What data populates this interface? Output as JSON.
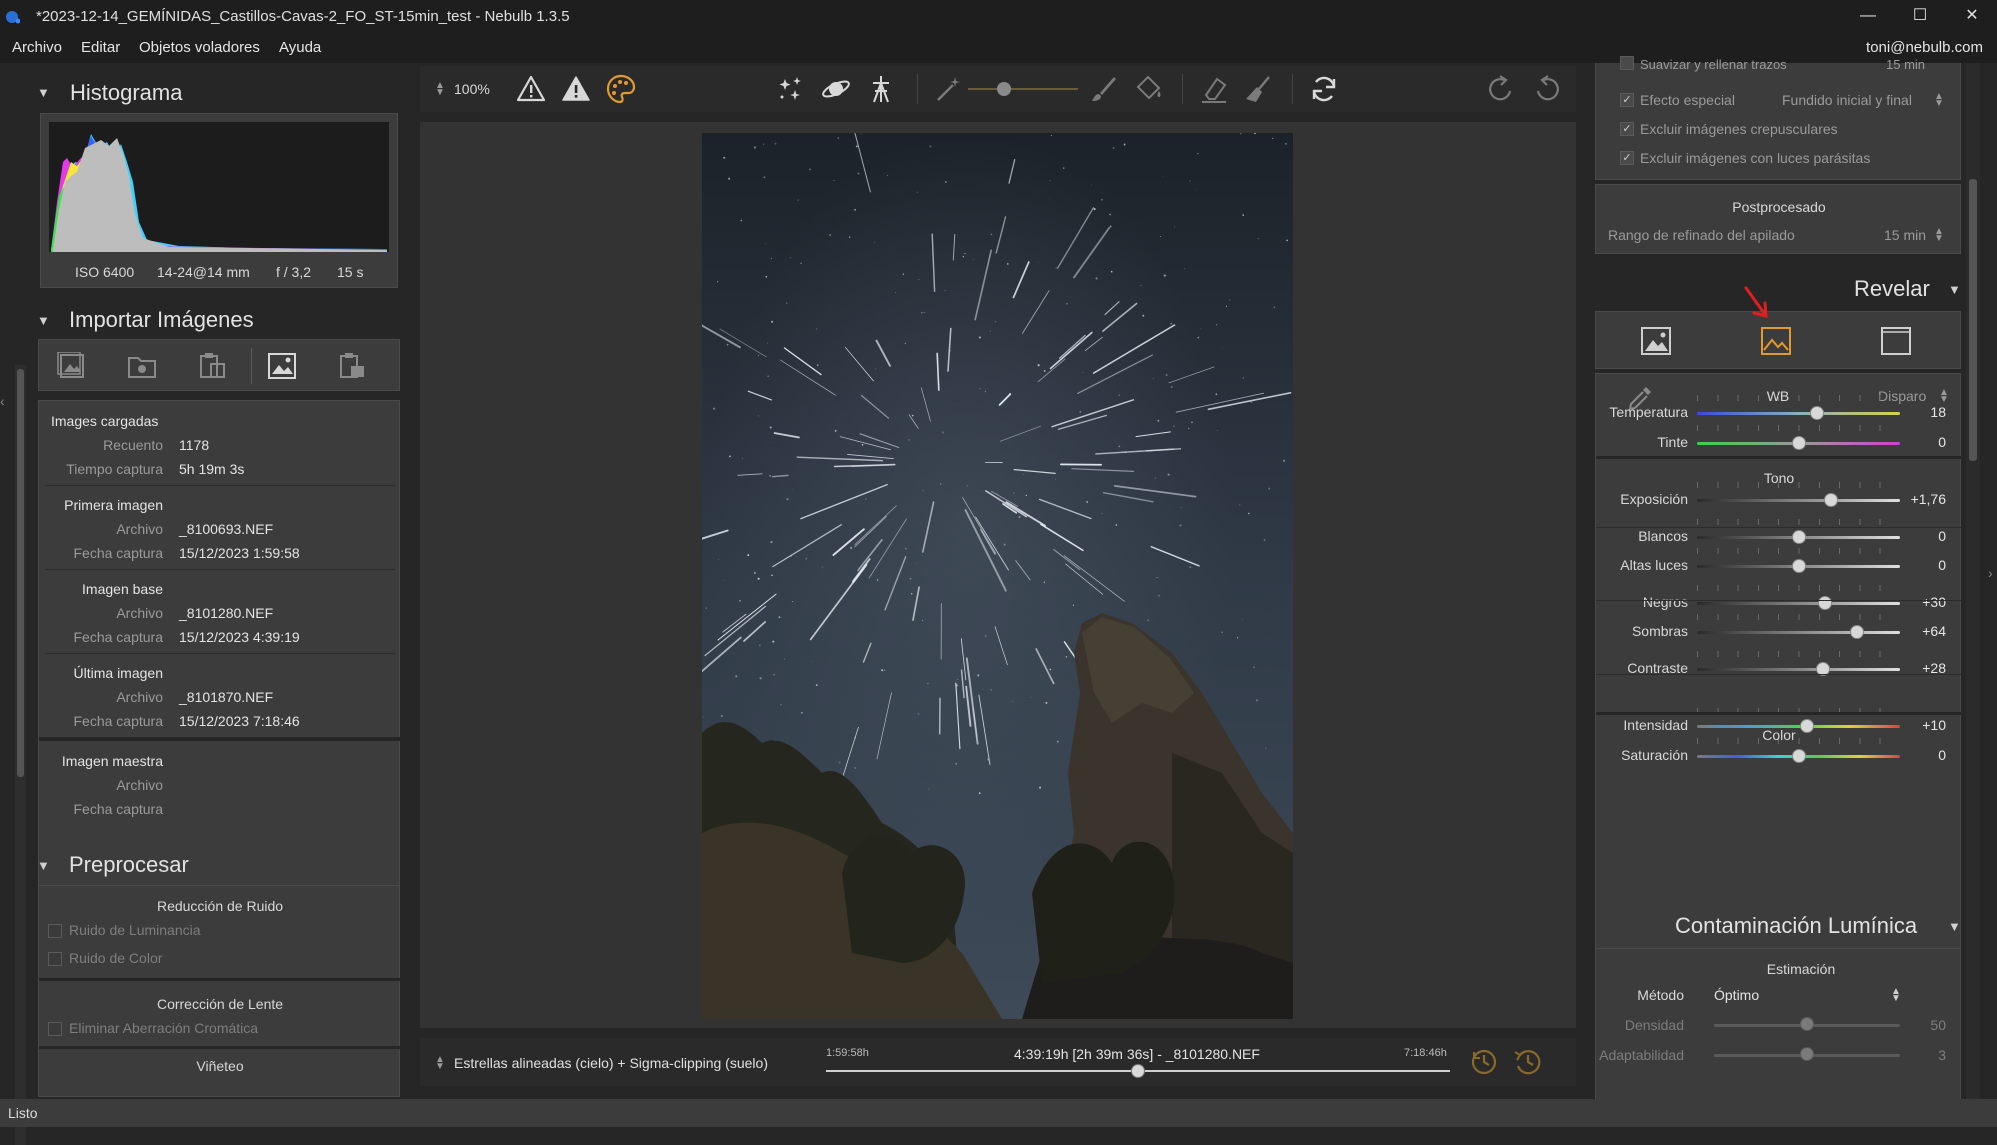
{
  "window": {
    "title": "*2023-12-14_GEMÍNIDAS_Castillos-Cavas-2_FO_ST-15min_test - Nebulb 1.3.5",
    "minimize": "—",
    "maximize": "☐",
    "close": "✕"
  },
  "menu": {
    "items": [
      "Archivo",
      "Editar",
      "Objetos voladores",
      "Ayuda"
    ],
    "user": "toni@nebulb.com"
  },
  "status": "Listo",
  "histogram": {
    "title": "Histograma",
    "iso": "ISO 6400",
    "lens": "14-24@14 mm",
    "aperture": "f / 3,2",
    "exposure": "15 s"
  },
  "import": {
    "title": "Importar Imágenes",
    "loaded_title": "Images cargadas",
    "count_label": "Recuento",
    "count_value": "1178",
    "capture_time_label": "Tiempo captura",
    "capture_time_value": "5h 19m 3s",
    "first": {
      "title": "Primera imagen",
      "file_label": "Archivo",
      "file": "_8100693.NEF",
      "date_label": "Fecha captura",
      "date": "15/12/2023 1:59:58"
    },
    "base": {
      "title": "Imagen base",
      "file_label": "Archivo",
      "file": "_8101280.NEF",
      "date_label": "Fecha captura",
      "date": "15/12/2023 4:39:19"
    },
    "last": {
      "title": "Última imagen",
      "file_label": "Archivo",
      "file": "_8101870.NEF",
      "date_label": "Fecha captura",
      "date": "15/12/2023 7:18:46"
    },
    "master": {
      "title": "Imagen maestra",
      "file_label": "Archivo",
      "date_label": "Fecha captura"
    }
  },
  "preprocess": {
    "title": "Preprocesar",
    "noise_title": "Reducción de Ruido",
    "luminance_noise": "Ruido de Luminancia",
    "color_noise": "Ruido de Color",
    "lens_title": "Corrección de Lente",
    "chromatic": "Eliminar Aberración Cromática",
    "vignette": "Viñeteo"
  },
  "toolbar": {
    "zoom": "100%"
  },
  "timeline": {
    "mode": "Estrellas alineadas (cielo) + Sigma-clipping (suelo)",
    "start": "1:59:58h",
    "current": "4:39:19h [2h 39m 36s] - _8101280.NEF",
    "end": "7:18:46h",
    "position": 0.5
  },
  "stack_options": {
    "cut_text": "Suavizar y rellenar trazos",
    "cut_value": "15 min",
    "special_effect_label": "Efecto especial",
    "special_effect_value": "Fundido inicial y final",
    "exclude_twilight": "Excluir imágenes crepusculares",
    "exclude_parasitic": "Excluir imágenes con luces parásitas",
    "post_title": "Postprocesado",
    "refine_label": "Rango de refinado del apilado",
    "refine_value": "15 min"
  },
  "develop": {
    "title": "Revelar",
    "wb_label": "WB",
    "wb_mode": "Disparo",
    "tone_title": "Tono",
    "color_title": "Color",
    "sliders": {
      "temperatura": {
        "label": "Temperatura",
        "value": "18",
        "pos": 0.59
      },
      "tinte": {
        "label": "Tinte",
        "value": "0",
        "pos": 0.5
      },
      "exposicion": {
        "label": "Exposición",
        "value": "+1,76",
        "pos": 0.66
      },
      "blancos": {
        "label": "Blancos",
        "value": "0",
        "pos": 0.5
      },
      "altas": {
        "label": "Altas luces",
        "value": "0",
        "pos": 0.5
      },
      "negros": {
        "label": "Negros",
        "value": "+30",
        "pos": 0.63
      },
      "sombras": {
        "label": "Sombras",
        "value": "+64",
        "pos": 0.79
      },
      "contraste": {
        "label": "Contraste",
        "value": "+28",
        "pos": 0.62
      },
      "intensidad": {
        "label": "Intensidad",
        "value": "+10",
        "pos": 0.54
      },
      "saturacion": {
        "label": "Saturación",
        "value": "0",
        "pos": 0.5
      }
    }
  },
  "light_pollution": {
    "title": "Contaminación Lumínica",
    "estimation_title": "Estimación",
    "method_label": "Método",
    "method_value": "Óptimo",
    "density_label": "Densidad",
    "density_value": "50",
    "density_pos": 0.5,
    "adapt_label": "Adaptabilidad",
    "adapt_value": "3",
    "adapt_pos": 0.5
  },
  "colors": {
    "accent": "#e39a2d",
    "panel": "#3c3c3c",
    "background": "#262626",
    "annotation_arrow": "#e02020"
  }
}
